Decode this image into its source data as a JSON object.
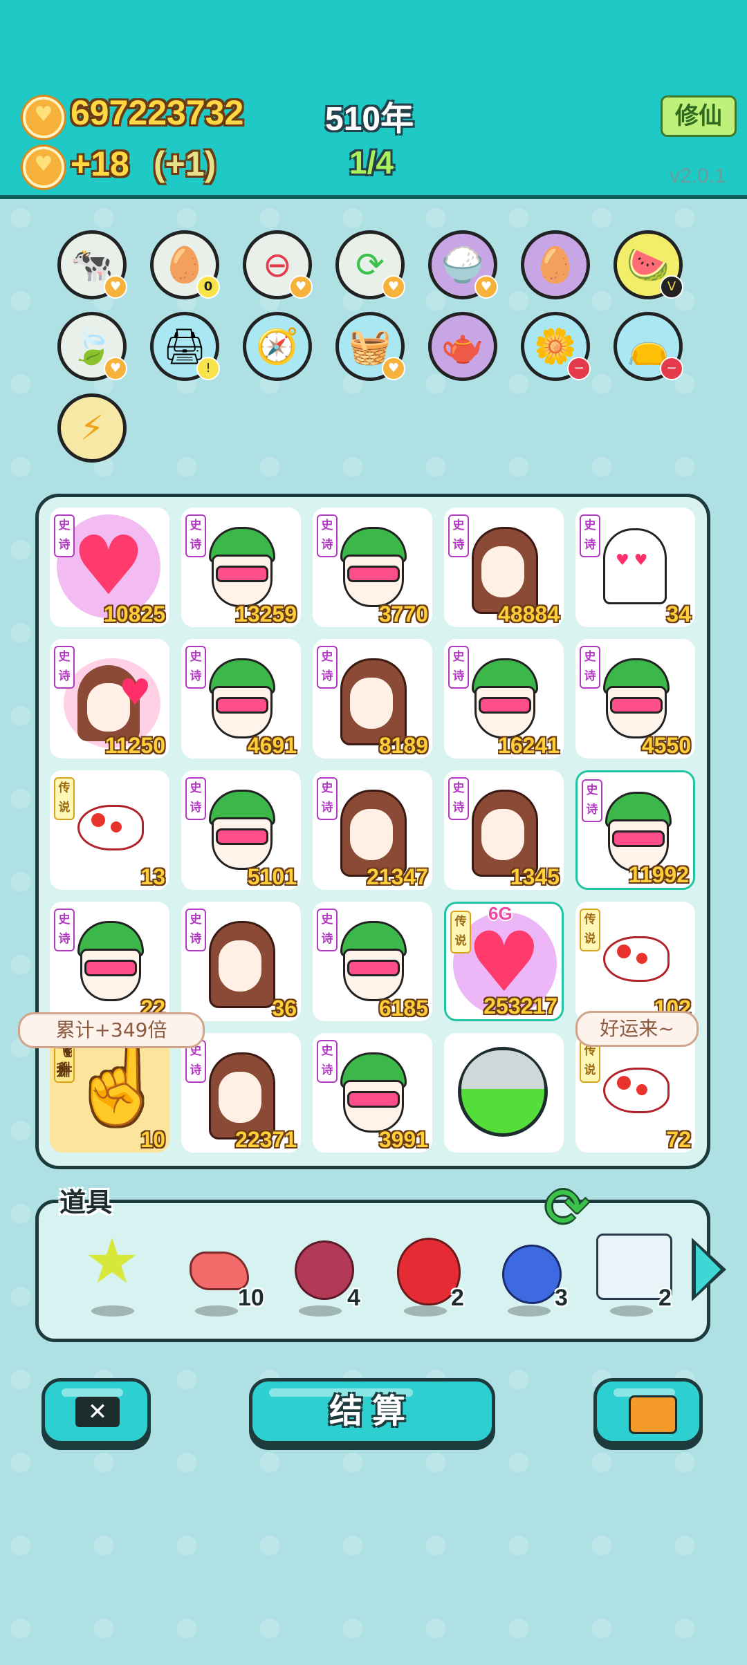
{
  "header": {
    "coins": "697223732",
    "income": "+18",
    "income_bonus": "(+1)",
    "year": "510年",
    "progress": "1/4",
    "mode_button": "修仙",
    "version": "v2.0.1"
  },
  "skills": [
    {
      "icon": "cow-pair-icon",
      "badge": "coin"
    },
    {
      "icon": "egg-tray-icon",
      "badge": "0"
    },
    {
      "icon": "no-entry-icon",
      "badge": "coin"
    },
    {
      "icon": "recycle-arrows-icon",
      "badge": "coin"
    },
    {
      "icon": "rice-bowl-icon",
      "badge": "coin"
    },
    {
      "icon": "egg-bag-icon",
      "badge": ""
    },
    {
      "icon": "fruit-platter-icon",
      "badge": "v"
    },
    {
      "icon": "leaf-icon",
      "badge": "coin"
    },
    {
      "icon": "printer-icon",
      "badge": "warning"
    },
    {
      "icon": "compass-icon",
      "badge": ""
    },
    {
      "icon": "fruit-basket-icon",
      "badge": "coin"
    },
    {
      "icon": "gravy-boat-icon",
      "badge": ""
    },
    {
      "icon": "flower-pot-icon",
      "badge": "minus"
    },
    {
      "icon": "sack-icon",
      "badge": "minus"
    },
    {
      "icon": "lightning-icon",
      "badge": ""
    }
  ],
  "board": {
    "cells": [
      {
        "tag": "史诗",
        "kind": "heart",
        "value": "10825"
      },
      {
        "tag": "史诗",
        "kind": "boy",
        "value": "13259"
      },
      {
        "tag": "史诗",
        "kind": "boy",
        "value": "3770"
      },
      {
        "tag": "史诗",
        "kind": "girl",
        "value": "48884"
      },
      {
        "tag": "史诗",
        "kind": "ghost",
        "value": "34"
      },
      {
        "tag": "史诗",
        "kind": "girl-heart",
        "value": "11250"
      },
      {
        "tag": "史诗",
        "kind": "boy",
        "value": "4691"
      },
      {
        "tag": "史诗",
        "kind": "girl",
        "value": "8189"
      },
      {
        "tag": "史诗",
        "kind": "boy",
        "value": "16241"
      },
      {
        "tag": "史诗",
        "kind": "boy",
        "value": "4550"
      },
      {
        "tag": "传说",
        "kind": "fish",
        "value": "13"
      },
      {
        "tag": "史诗",
        "kind": "boy",
        "value": "5101"
      },
      {
        "tag": "史诗",
        "kind": "girl",
        "value": "21347"
      },
      {
        "tag": "史诗",
        "kind": "girl",
        "value": "1345"
      },
      {
        "tag": "史诗",
        "kind": "boy",
        "value": "11992"
      },
      {
        "tag": "史诗",
        "kind": "boy",
        "value": "22"
      },
      {
        "tag": "史诗",
        "kind": "girl",
        "value": "36"
      },
      {
        "tag": "史诗",
        "kind": "boy",
        "value": "6185"
      },
      {
        "tag": "传说",
        "kind": "heart-big",
        "value": "253217"
      },
      {
        "tag": "传说",
        "kind": "fish",
        "value": "102"
      },
      {
        "tag": "飞升",
        "kind": "finger",
        "value": "10"
      },
      {
        "tag": "史诗",
        "kind": "girl",
        "value": "22371"
      },
      {
        "tag": "史诗",
        "kind": "boy",
        "value": "3991"
      },
      {
        "tag": "",
        "kind": "capsule",
        "value": ""
      },
      {
        "tag": "传说",
        "kind": "fish",
        "value": "72"
      }
    ],
    "six_g": "6G",
    "bubble_left": "累计+349倍",
    "bubble_right": "好运来~"
  },
  "items": {
    "title": "道具",
    "list": [
      {
        "icon": "star-icon",
        "count": ""
      },
      {
        "icon": "liver-icon",
        "count": "10"
      },
      {
        "icon": "lychee-icon",
        "count": "4"
      },
      {
        "icon": "strawberry-icon",
        "count": "2"
      },
      {
        "icon": "blueberry-icon",
        "count": "3"
      },
      {
        "icon": "battery-icon",
        "count": "2"
      }
    ]
  },
  "buttons": {
    "settle": "结算"
  },
  "colors": {
    "header_bg": "#1ec9c6",
    "body_bg": "#aee0e4",
    "coin_text": "#ffd844",
    "progress_text": "#a9f05a"
  }
}
